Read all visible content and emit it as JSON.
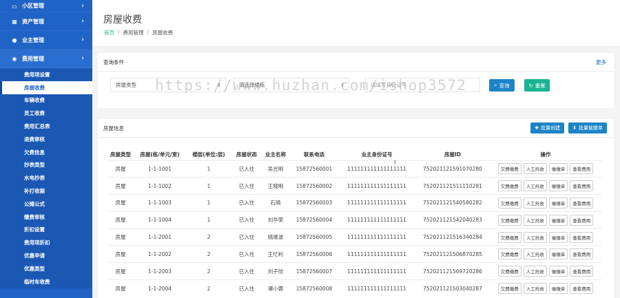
{
  "sidebar": {
    "groups": [
      {
        "label": "小区管理",
        "icon": "monitor-icon"
      },
      {
        "label": "资产管理",
        "icon": "grid-icon"
      },
      {
        "label": "业主管理",
        "icon": "user-icon"
      },
      {
        "label": "费用管理",
        "icon": "coin-icon"
      }
    ],
    "chevron": "›",
    "items": [
      "费用项设置",
      "房屋收费",
      "车辆收费",
      "员工收费",
      "费用汇总表",
      "退费审核",
      "欠费信息",
      "抄表类型",
      "水电抄表",
      "补打收据",
      "公摊公式",
      "缴费审核",
      "折扣设置",
      "费用项折扣",
      "优惠申请",
      "优惠类型",
      "临时车收费"
    ]
  },
  "header": {
    "title": "房屋收费",
    "breadcrumb": [
      "首页",
      "费用管理",
      "房屋收费"
    ],
    "sep": "/"
  },
  "query": {
    "title": "查询条件",
    "more": "更多",
    "house_type": "房屋类型",
    "house_select": "请选择楼栋",
    "id_placeholder": "请填写身份证号",
    "search_label": "查询",
    "reset_label": "重置"
  },
  "info": {
    "title": "房屋信息",
    "batch_create": "批量创建",
    "batch_urge": "批量催缴单",
    "columns": [
      "房屋类型",
      "房屋(栋/单元/室)",
      "楼层(单位:层)",
      "房屋状态",
      "业主名称",
      "联系电话",
      "业主身份证号",
      "房屋ID",
      "操作"
    ],
    "ops": [
      "欠费缴费",
      "人工托收",
      "催缴单",
      "查看费用"
    ],
    "rows": [
      [
        "房屋",
        "1-1-1001",
        "1",
        "已入住",
        "吴光明",
        "15872560001",
        "111111111111111111",
        "752021121591070280"
      ],
      [
        "房屋",
        "1-1-1002",
        "1",
        "已入住",
        "王晓明",
        "15872560002",
        "111111111111111111",
        "752021121511110281"
      ],
      [
        "房屋",
        "1-1-1003",
        "1",
        "已入住",
        "石晴",
        "15872560003",
        "111111111111111111",
        "752021121540580282"
      ],
      [
        "房屋",
        "1-1-1004",
        "1",
        "已入住",
        "刘华荣",
        "15872560004",
        "111111111111111111",
        "752021121542040283"
      ],
      [
        "房屋",
        "1-1-2001",
        "2",
        "已入住",
        "姚顺波",
        "15872560005",
        "111111111111111111",
        "752021121516340284"
      ],
      [
        "房屋",
        "1-1-2002",
        "2",
        "已入住",
        "王忙利",
        "15872560006",
        "111111111111111111",
        "752021121506870285"
      ],
      [
        "房屋",
        "1-1-2003",
        "2",
        "已入住",
        "刘子欣",
        "15872560007",
        "111111111111111111",
        "752021121569720286"
      ],
      [
        "房屋",
        "1-1-2004",
        "2",
        "已入住",
        "谭小蓉",
        "15872560008",
        "111111111111111111",
        "752021121503040287"
      ]
    ]
  },
  "watermark": "https://www.huzhan.com/ishop3572",
  "colors": {
    "sidebar": "#1f63c6",
    "accent": "#1c84c6",
    "teal": "#1ab394"
  }
}
